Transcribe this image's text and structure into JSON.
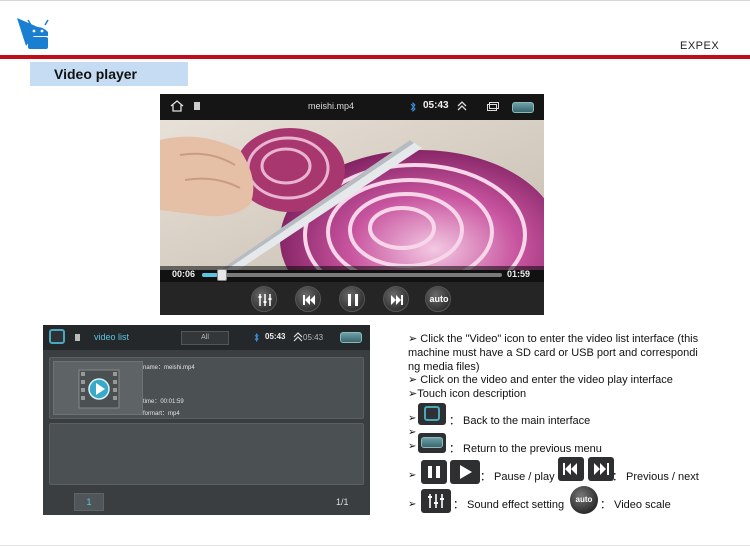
{
  "header": {
    "brand": "EXPEX",
    "section_title": "Video player",
    "accent_red": "#c00d1a",
    "title_bg": "#c5dcf2",
    "logo_icon": "android-robot-logo"
  },
  "player": {
    "file_name": "meishi.mp4",
    "clock": "05:43",
    "elapsed": "00:06",
    "duration": "01:59",
    "progress_fraction": 0.05,
    "auto_label": "auto",
    "icons": [
      "home-icon",
      "sd-card-icon",
      "bluetooth-icon",
      "double-chevron-up-icon",
      "windows-icon",
      "back-icon",
      "equalizer-icon",
      "previous-icon",
      "pause-icon",
      "next-icon"
    ],
    "accent": "#57c6de"
  },
  "video_list": {
    "title": "video list",
    "tab_label": "All",
    "clock": "05:43",
    "clock_echo": "05:43",
    "item": {
      "name": "name：meishi.mp4",
      "time": "time：00:01:59",
      "format": "formart：mp4"
    },
    "page_button": "1",
    "page_count": "1/1"
  },
  "instructions": {
    "line1": "➢ Click the \"Video\" icon to enter the video list interface (this",
    "line2": "machine must have a SD card or USB port and correspondi",
    "line3": "ng media files)",
    "line4": "➢ Click on the video and enter the video play interface",
    "line5": "➢Touch icon description",
    "home_desc": "：  Back to the main interface",
    "back_desc": "：  Return to the previous menu",
    "playpause_desc": "：  Pause / play",
    "prevnext_desc": "：  Previous / next",
    "sound_desc": "：  Sound effect setting",
    "scale_desc": "：  Video scale",
    "auto_label": "auto"
  }
}
